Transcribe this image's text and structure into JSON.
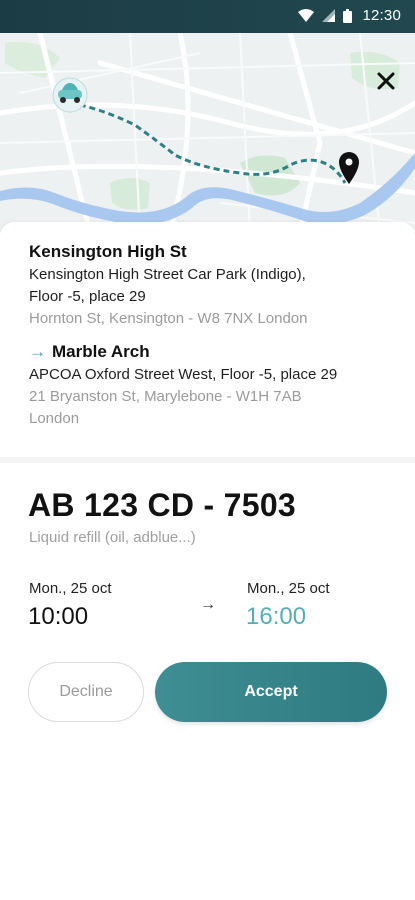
{
  "status_bar": {
    "time": "12:30",
    "icons": [
      "wifi-icon",
      "signal-icon",
      "battery-icon"
    ]
  },
  "map": {
    "icons": [
      "car-icon",
      "location-pin-icon",
      "close-icon"
    ],
    "route_color": "#2f7f86"
  },
  "route": {
    "origin": {
      "title": "Kensington High St",
      "place": "Kensington High Street Car Park (Indigo),",
      "floor": "Floor -5, place 29",
      "address": "Hornton St, Kensington - W8 7NX London"
    },
    "destination": {
      "arrow": "→",
      "title": "Marble Arch",
      "place": "APCOA Oxford Street West, Floor -5, place 29",
      "address_line1": "21 Bryanston St, Marylebone - W1H 7AB",
      "address_line2": "London"
    }
  },
  "mission": {
    "plate": "AB 123 CD - 7503",
    "service": "Liquid refill (oil, adblue...)",
    "start": {
      "date": "Mon., 25 oct",
      "time": "10:00"
    },
    "arrow": "→",
    "end": {
      "date": "Mon., 25 oct",
      "time": "16:00"
    }
  },
  "actions": {
    "decline": "Decline",
    "accept": "Accept"
  },
  "colors": {
    "accent": "#3f9da1",
    "accept_button": "#35848a",
    "status_bar": "#1f4249"
  }
}
